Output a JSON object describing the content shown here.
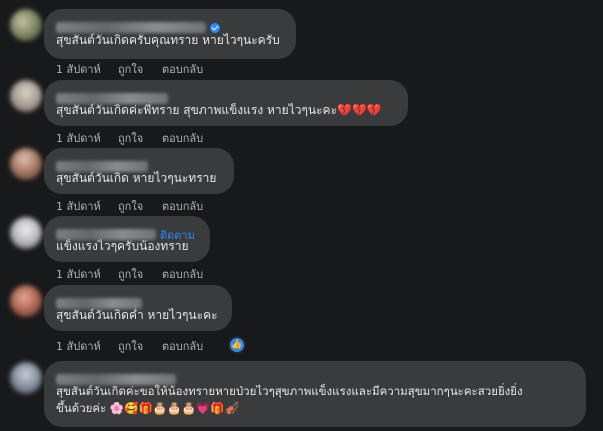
{
  "comments": [
    {
      "text": "สุขสันต์วันเกิดครับคุณทราย หายไวๆนะครับ",
      "time": "1 สัปดาห์",
      "like": "ถูกใจ",
      "reply": "ตอบกลับ",
      "verified": true
    },
    {
      "text": "สุขสันต์วันเกิดค่ะพี่ทราย สุขภาพแข็งแรง หายไวๆนะคะ💔💔💔",
      "time": "1 สัปดาห์",
      "like": "ถูกใจ",
      "reply": "ตอบกลับ"
    },
    {
      "text": "สุขสันต์วันเกิด หายไวๆนะทราย",
      "time": "1 สัปดาห์",
      "like": "ถูกใจ",
      "reply": "ตอบกลับ"
    },
    {
      "text": "แข็งแรงไวๆครับน้องทราย",
      "follow": "ติดตาม",
      "time": "1 สัปดาห์",
      "like": "ถูกใจ",
      "reply": "ตอบกลับ"
    },
    {
      "text": "สุขสันต์วันเกิดค่ำ หายไวๆนะคะ",
      "time": "1 สัปดาห์",
      "like": "ถูกใจ",
      "reply": "ตอบกลับ",
      "reaction_icon": "thumbs-up-icon"
    },
    {
      "text_line1": "สุขสันต์วันเกิดค่ะขอให้น้องทรายหายป่วยไวๆสุขภาพแข็งแรงและมีความสุขมากๆนะคะสวยยิ่งยิ่ง",
      "text_line2": "ขึ้นด้วยค่ะ 🌸🥰🎁🎂🎂🎂💗🎁🎻"
    }
  ],
  "colors": {
    "bubble": "#3a3b3c",
    "background": "#18191a",
    "link": "#2d88ff",
    "meta": "#b0b3b8"
  }
}
